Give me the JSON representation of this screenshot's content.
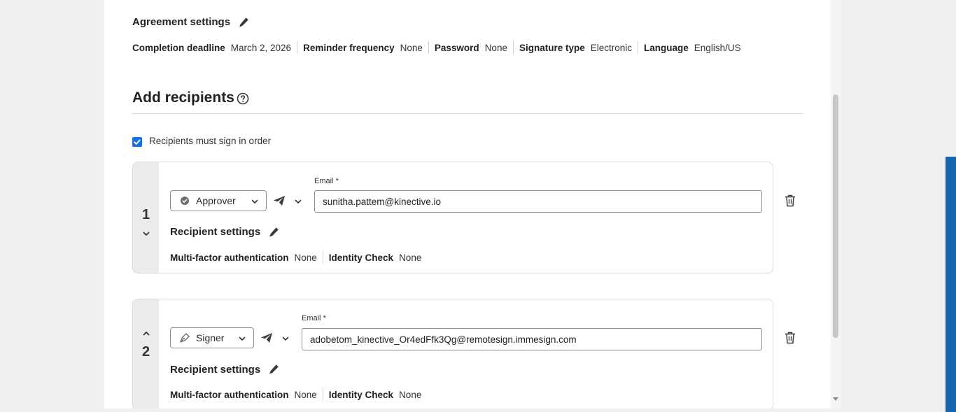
{
  "agreement_settings": {
    "title": "Agreement settings",
    "items": [
      {
        "label": "Completion deadline",
        "value": "March 2, 2026"
      },
      {
        "label": "Reminder frequency",
        "value": "None"
      },
      {
        "label": "Password",
        "value": "None"
      },
      {
        "label": "Signature type",
        "value": "Electronic"
      },
      {
        "label": "Language",
        "value": "English/US"
      }
    ]
  },
  "add_recipients": {
    "title": "Add recipients",
    "sign_in_order_label": "Recipients must sign in order",
    "sign_in_order_checked": true
  },
  "recipients": [
    {
      "number": "1",
      "role": "Approver",
      "role_icon": "check-circle-icon",
      "email_label": "Email",
      "required_mark": "*",
      "email": "sunitha.pattem@kinective.io",
      "settings_title": "Recipient settings",
      "settings": [
        {
          "label": "Multi-factor authentication",
          "value": "None"
        },
        {
          "label": "Identity Check",
          "value": "None"
        }
      ]
    },
    {
      "number": "2",
      "role": "Signer",
      "role_icon": "pen-nib-icon",
      "email_label": "Email",
      "required_mark": "*",
      "email": "adobetom_kinective_Or4edFfk3Qg@remotesign.immesign.com",
      "settings_title": "Recipient settings",
      "settings": [
        {
          "label": "Multi-factor authentication",
          "value": "None"
        },
        {
          "label": "Identity Check",
          "value": "None"
        }
      ]
    }
  ],
  "colors": {
    "accent": "#1473e6",
    "side_bar": "#1565b0",
    "page_bg": "#efefef"
  }
}
